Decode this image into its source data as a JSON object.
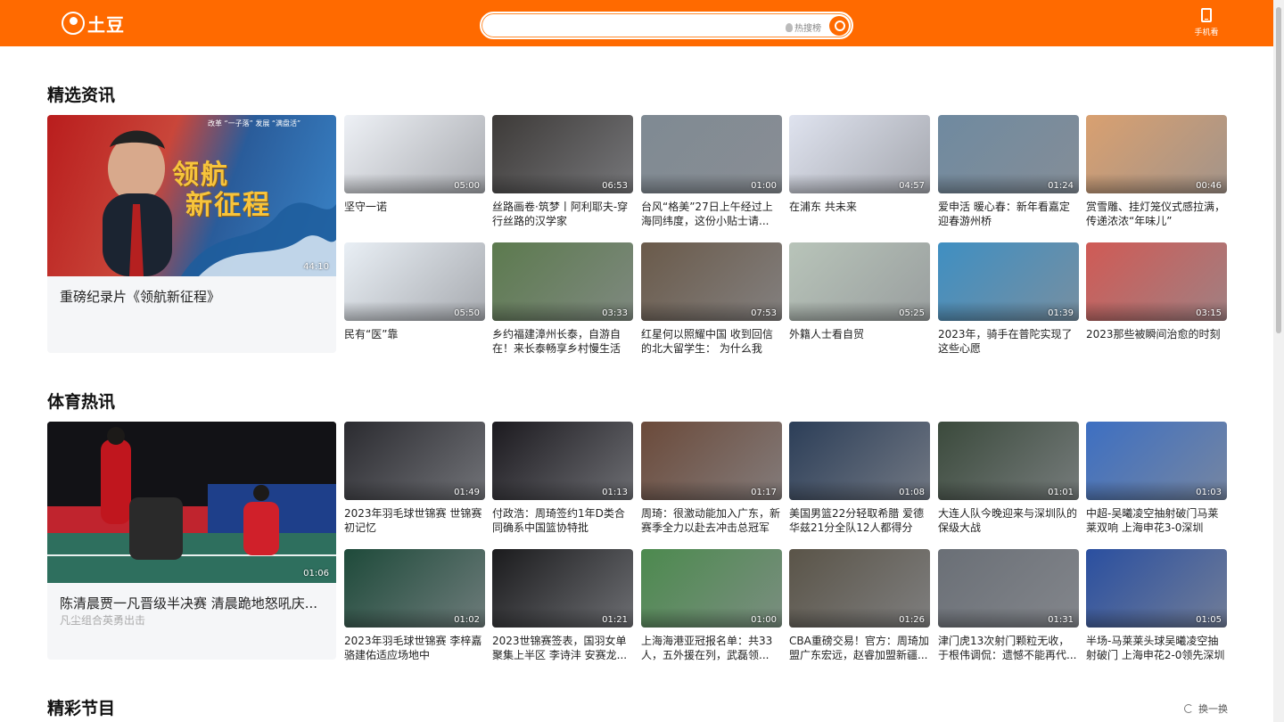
{
  "header": {
    "logo_text": "土豆",
    "search_placeholder": "",
    "hot_label": "热搜榜",
    "mobile_label": "手机看",
    "brand_color": "#ff6a00"
  },
  "sections": [
    {
      "title": "精选资讯",
      "featured": {
        "title": "重磅纪录片《领航新征程》",
        "subtitle": "",
        "duration": "44:10",
        "banner_line1": "领航",
        "banner_line2": "新征程",
        "banner_caption": "改革 “一子落” 发展 “满盘活”"
      },
      "cards": [
        {
          "title": "坚守一诺",
          "duration": "05:00"
        },
        {
          "title": "丝路画卷·筑梦丨阿利耶夫-穿行丝路的汉学家",
          "duration": "06:53"
        },
        {
          "title": "台风“格美”27日上午经过上海同纬度，这份小贴士请...",
          "duration": "01:00"
        },
        {
          "title": "在浦东 共未来",
          "duration": "04:57"
        },
        {
          "title": "爱申活 暖心春：新年看嘉定迎春游州桥",
          "duration": "01:24"
        },
        {
          "title": "赏雪雕、挂灯笼仪式感拉满，传递浓浓“年味儿”",
          "duration": "00:46"
        },
        {
          "title": "民有“医”靠",
          "duration": "05:50"
        },
        {
          "title": "乡约福建漳州长泰，自游自在！来长泰畅享乡村慢生活",
          "duration": "03:33"
        },
        {
          "title": "红星何以照耀中国  收到回信的北大留学生： 为什么我想...",
          "duration": "07:53"
        },
        {
          "title": "外籍人士看自贸",
          "duration": "05:25"
        },
        {
          "title": "2023年，骑手在普陀实现了这些心愿",
          "duration": "01:39"
        },
        {
          "title": "2023那些被瞬间治愈的时刻",
          "duration": "03:15"
        }
      ]
    },
    {
      "title": "体育热讯",
      "featured": {
        "title": "陈清晨贾一凡晋级半决赛 清晨跪地怒吼庆...",
        "subtitle": "凡尘组合英勇出击",
        "duration": "01:06"
      },
      "cards": [
        {
          "title": "2023年羽毛球世锦赛 世锦赛初记忆",
          "duration": "01:49"
        },
        {
          "title": "付政浩：周琦签约1年D类合同确系中国篮协特批",
          "duration": "01:13"
        },
        {
          "title": "周琦：很激动能加入广东，新赛季全力以赴去冲击总冠军",
          "duration": "01:17"
        },
        {
          "title": "美国男篮22分轻取希腊 爱德华兹21分全队12人都得分",
          "duration": "01:08"
        },
        {
          "title": "大连人队今晚迎来与深圳队的保级大战",
          "duration": "01:01"
        },
        {
          "title": "中超-吴曦凌空抽射破门马莱莱双响 上海申花3-0深圳",
          "duration": "01:03"
        },
        {
          "title": "2023年羽毛球世锦赛 李梓嘉骆建佑适应场地中",
          "duration": "01:02"
        },
        {
          "title": "2023世锦赛签表，国羽女单聚集上半区 李诗沣 安赛龙...",
          "duration": "01:21"
        },
        {
          "title": "上海海港亚冠报名单：共33人，五外援在列，武磊领...",
          "duration": "01:00"
        },
        {
          "title": "CBA重磅交易！官方：周琦加盟广东宏远，赵睿加盟新疆...",
          "duration": "01:26"
        },
        {
          "title": "津门虎13次射门颗粒无收，于根伟调侃：遗憾不能再代...",
          "duration": "01:31"
        },
        {
          "title": "半场-马莱莱头球吴曦凌空抽射破门 上海申花2-0领先深圳",
          "duration": "01:05"
        }
      ]
    },
    {
      "title": "精彩节目",
      "refresh_label": "换一换"
    }
  ],
  "thumb_colors": {
    "s0": [
      "#eef1f6",
      "#3d3a38",
      "#7f8a93",
      "#dfe3ef",
      "#6f8aa0",
      "#d9a070",
      "#e9eff5",
      "#5c7a4e",
      "#6a5a4a",
      "#b8c4b9",
      "#3f8fc2",
      "#d05a55"
    ],
    "s1": [
      "#2b2b30",
      "#1c1a1f",
      "#6b4a3a",
      "#2c3e58",
      "#3b4a3c",
      "#3d6fc2",
      "#1e4a3a",
      "#1b1b1d",
      "#4c8a4e",
      "#5a5448",
      "#6a6f76",
      "#2a4fa0"
    ]
  }
}
